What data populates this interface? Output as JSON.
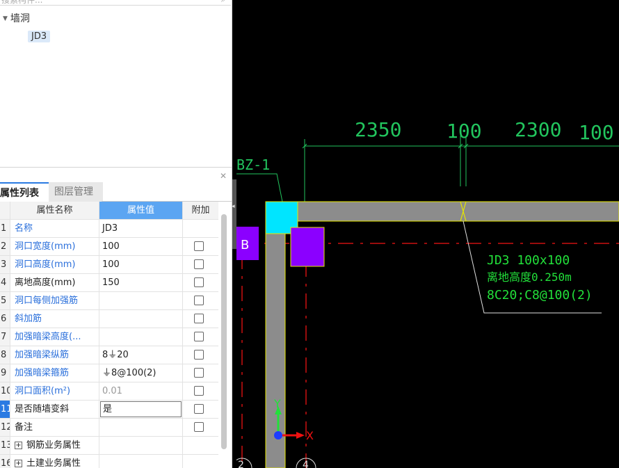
{
  "search": {
    "placeholder": "搜索构件..."
  },
  "tree": {
    "root": "墙洞",
    "child": "JD3"
  },
  "tabs": {
    "properties": "属性列表",
    "layers": "图层管理"
  },
  "grid": {
    "headers": {
      "name": "属性名称",
      "value": "属性值",
      "extra": "附加"
    },
    "rows": [
      {
        "num": "1",
        "name": "名称",
        "value": "JD3"
      },
      {
        "num": "2",
        "name": "洞口宽度(mm)",
        "value": "100"
      },
      {
        "num": "3",
        "name": "洞口高度(mm)",
        "value": "100"
      },
      {
        "num": "4",
        "name": "离地高度(mm)",
        "value": "150"
      },
      {
        "num": "5",
        "name": "洞口每侧加强筋",
        "value": ""
      },
      {
        "num": "6",
        "name": "斜加筋",
        "value": ""
      },
      {
        "num": "7",
        "name": "加强暗梁高度(...",
        "value": ""
      },
      {
        "num": "8",
        "name": "加强暗梁纵筋",
        "value": "8⏚20"
      },
      {
        "num": "9",
        "name": "加强暗梁箍筋",
        "value": "⏚8@100(2)"
      },
      {
        "num": "10",
        "name": "洞口面积(m²)",
        "value": "0.01"
      },
      {
        "num": "11",
        "name": "是否随墙变斜",
        "value": "是"
      },
      {
        "num": "12",
        "name": "备注",
        "value": ""
      },
      {
        "num": "13",
        "name": "钢筋业务属性",
        "value": ""
      },
      {
        "num": "16",
        "name": "土建业务属性",
        "value": ""
      }
    ]
  },
  "cad": {
    "dims": [
      "2350",
      "100",
      "2300",
      "100"
    ],
    "bz_label": "BZ-1",
    "axis_b": "B",
    "axis_2": "2",
    "axis_4": "4",
    "annotation": [
      "JD3 100x100",
      "离地高度0.250m",
      "8C20;C8@100(2)"
    ],
    "ucs_y": "Y",
    "ucs_x": "X",
    "colors": {
      "dim": "#22c55e",
      "wall": "#8c8c8c",
      "wall_edge": "#e6e600",
      "column": "#00e5ff",
      "purple": "#8b00ff",
      "axis_red": "#d11",
      "text_green": "#22e03a"
    }
  }
}
